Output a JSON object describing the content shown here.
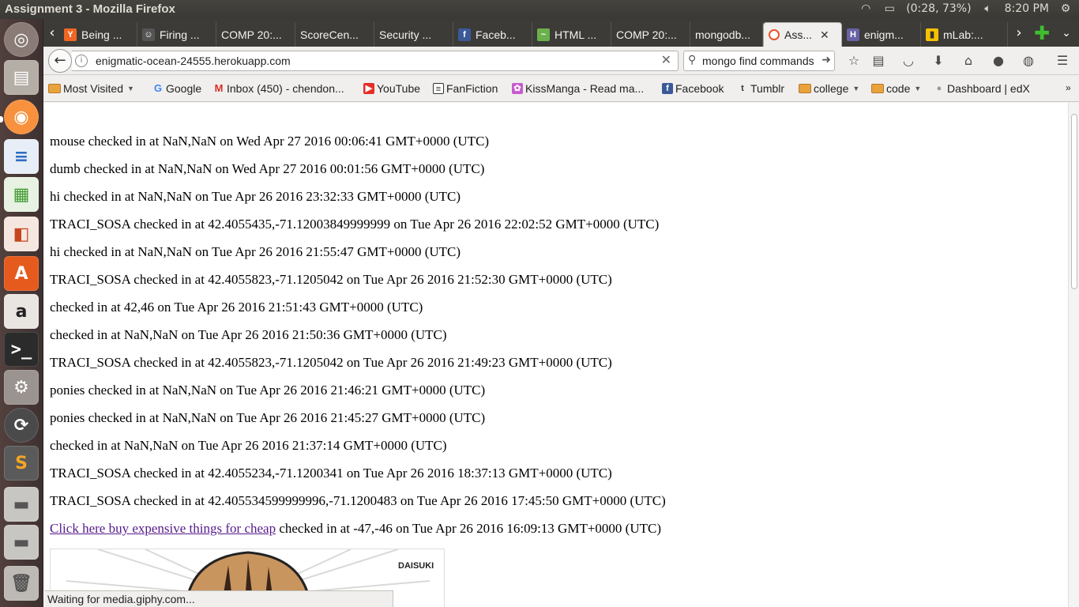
{
  "panel": {
    "window_title": "Assignment 3 - Mozilla Firefox",
    "battery": "(0:28, 73%)",
    "clock": "8:20 PM"
  },
  "launcher": {
    "items": [
      "dash-icon",
      "files-icon",
      "firefox-icon",
      "writer-icon",
      "calc-icon",
      "impress-icon",
      "software-center-icon",
      "amazon-icon",
      "terminal-icon",
      "settings-icon",
      "updater-icon",
      "sublime-icon",
      "drive-icon",
      "drive-icon",
      "trash-icon"
    ]
  },
  "tabs": [
    {
      "label": "Being ...",
      "icon": "Y",
      "color": "#f26522"
    },
    {
      "label": "Firing ...",
      "icon": "☺",
      "color": "#555555"
    },
    {
      "label": "COMP 20:...",
      "icon": "",
      "color": ""
    },
    {
      "label": "ScoreCen...",
      "icon": "",
      "color": ""
    },
    {
      "label": "Security ...",
      "icon": "",
      "color": ""
    },
    {
      "label": "Faceb...",
      "icon": "f",
      "color": "#3b5998"
    },
    {
      "label": "HTML ...",
      "icon": "~",
      "color": "#6ab04c"
    },
    {
      "label": "COMP 20:...",
      "icon": "",
      "color": ""
    },
    {
      "label": "mongodb...",
      "icon": "",
      "color": ""
    },
    {
      "label": "Ass...",
      "icon": "○",
      "color": "#e8532c"
    },
    {
      "label": "enigm...",
      "icon": "H",
      "color": "#6762a6"
    },
    {
      "label": "mLab:...",
      "icon": "▮",
      "color": "#f5c000"
    }
  ],
  "navbar": {
    "url": "enigmatic-ocean-24555.herokuapp.com",
    "search_query": "mongo find commands"
  },
  "bookmarks": [
    {
      "label": "Most Visited",
      "kind": "folder-menu"
    },
    {
      "label": "Google",
      "kind": "google"
    },
    {
      "label": "Inbox (450) - chendon...",
      "kind": "gmail"
    },
    {
      "label": "YouTube",
      "kind": "youtube"
    },
    {
      "label": "FanFiction",
      "kind": "fanfiction"
    },
    {
      "label": "KissManga - Read ma...",
      "kind": "kissmanga"
    },
    {
      "label": "Facebook",
      "kind": "facebook"
    },
    {
      "label": "Tumblr",
      "kind": "tumblr"
    },
    {
      "label": "college",
      "kind": "folder"
    },
    {
      "label": "code",
      "kind": "folder"
    },
    {
      "label": "Dashboard | edX",
      "kind": "edx"
    }
  ],
  "checkins": [
    {
      "who": "mouse",
      "text": " checked in at NaN,NaN on Wed Apr 27 2016 00:06:41 GMT+0000 (UTC)"
    },
    {
      "who": "dumb",
      "text": " checked in at NaN,NaN on Wed Apr 27 2016 00:01:56 GMT+0000 (UTC)"
    },
    {
      "who": "hi",
      "text": " checked in at NaN,NaN on Tue Apr 26 2016 23:32:33 GMT+0000 (UTC)"
    },
    {
      "who": "TRACI_SOSA",
      "text": " checked in at 42.4055435,-71.12003849999999 on Tue Apr 26 2016 22:02:52 GMT+0000 (UTC)"
    },
    {
      "who": "hi",
      "text": " checked in at NaN,NaN on Tue Apr 26 2016 21:55:47 GMT+0000 (UTC)"
    },
    {
      "who": "TRACI_SOSA",
      "text": " checked in at 42.4055823,-71.1205042 on Tue Apr 26 2016 21:52:30 GMT+0000 (UTC)"
    },
    {
      "who": "",
      "text": "checked in at 42,46 on Tue Apr 26 2016 21:51:43 GMT+0000 (UTC)"
    },
    {
      "who": "",
      "text": "checked in at NaN,NaN on Tue Apr 26 2016 21:50:36 GMT+0000 (UTC)"
    },
    {
      "who": "TRACI_SOSA",
      "text": " checked in at 42.4055823,-71.1205042 on Tue Apr 26 2016 21:49:23 GMT+0000 (UTC)"
    },
    {
      "who": "ponies",
      "text": " checked in at NaN,NaN on Tue Apr 26 2016 21:46:21 GMT+0000 (UTC)"
    },
    {
      "who": "ponies",
      "text": " checked in at NaN,NaN on Tue Apr 26 2016 21:45:27 GMT+0000 (UTC)"
    },
    {
      "who": "",
      "text": "checked in at NaN,NaN on Tue Apr 26 2016 21:37:14 GMT+0000 (UTC)"
    },
    {
      "who": "TRACI_SOSA",
      "text": " checked in at 42.4055234,-71.1200341 on Tue Apr 26 2016 18:37:13 GMT+0000 (UTC)"
    },
    {
      "who": "TRACI_SOSA",
      "text": " checked in at 42.405534599999996,-71.1200483 on Tue Apr 26 2016 17:45:50 GMT+0000 (UTC)"
    }
  ],
  "link_checkin": {
    "link_text": "Click here buy expensive things for cheap",
    "text": " checked in at -47,-46 on Tue Apr 26 2016 16:09:13 GMT+0000 (UTC)"
  },
  "gif": {
    "watermark": "DAISUKI"
  },
  "status": "Waiting for media.giphy.com..."
}
